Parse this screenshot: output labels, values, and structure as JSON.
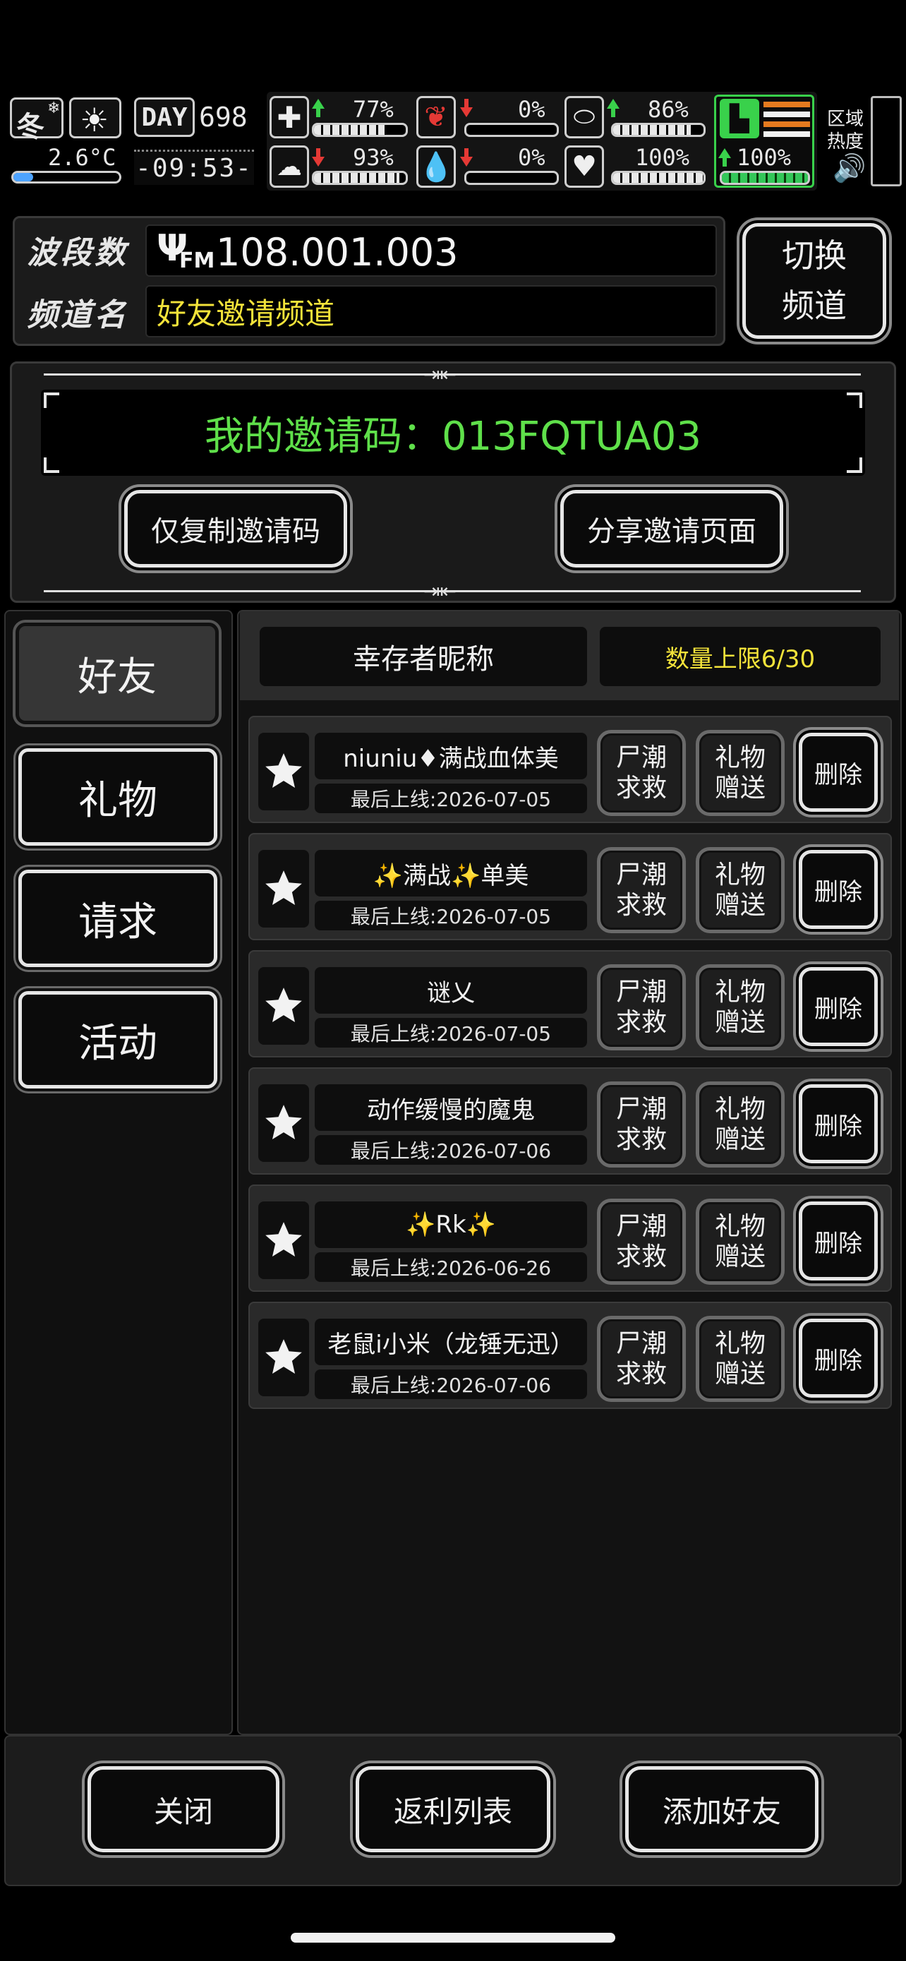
{
  "hud": {
    "season": "冬",
    "temperature": "2.6°C",
    "day_label": "DAY",
    "day_number": "698",
    "clock": "-09:53-",
    "region_heat_label_1": "区域",
    "region_heat_label_2": "热度",
    "stats": [
      {
        "key": "health",
        "value": "77%",
        "trend": "up",
        "fill": 0.77,
        "icon": "first-aid-icon"
      },
      {
        "key": "hunger",
        "value": "0%",
        "trend": "down",
        "fill": 0.0,
        "icon": "stomach-icon"
      },
      {
        "key": "sanity",
        "value": "86%",
        "trend": "up",
        "fill": 0.86,
        "icon": "pill-icon"
      },
      {
        "key": "mental",
        "value": "93%",
        "trend": "down",
        "fill": 0.93,
        "icon": "brain-icon"
      },
      {
        "key": "thirst",
        "value": "0%",
        "trend": "down",
        "fill": 0.0,
        "icon": "water-drop-icon"
      },
      {
        "key": "mood",
        "value": "100%",
        "trend": "none",
        "fill": 1.0,
        "icon": "heart-icon"
      },
      {
        "key": "stamina",
        "value": "100%",
        "trend": "up",
        "fill": 1.0,
        "icon": "boot-icon"
      }
    ]
  },
  "radio": {
    "band_label": "波段数",
    "frequency": "108.001.003",
    "fm_label": "FM",
    "channel_label": "频道名",
    "channel_name": "好友邀请频道",
    "switch_button": "切换\n频道",
    "switch_line1": "切换",
    "switch_line2": "频道"
  },
  "invite": {
    "code_text": "我的邀请码：013FQTUA03",
    "copy_button": "仅复制邀请码",
    "share_button": "分享邀请页面"
  },
  "tabs": [
    {
      "label": "好友",
      "active": true
    },
    {
      "label": "礼物",
      "active": false
    },
    {
      "label": "请求",
      "active": false
    },
    {
      "label": "活动",
      "active": false
    }
  ],
  "list_header": {
    "name_column": "幸存者昵称",
    "limit_text": "数量上限6/30"
  },
  "actions": {
    "rescue_line1": "尸潮",
    "rescue_line2": "求救",
    "gift_line1": "礼物",
    "gift_line2": "赠送",
    "delete": "删除"
  },
  "friends": [
    {
      "name": "niuniu♦满战血体美",
      "last_online": "最后上线:2026-07-05"
    },
    {
      "name": "✨满战✨单美",
      "last_online": "最后上线:2026-07-05"
    },
    {
      "name": "谜乂",
      "last_online": "最后上线:2026-07-05"
    },
    {
      "name": "动作缓慢的魔鬼",
      "last_online": "最后上线:2026-07-06"
    },
    {
      "name": "✨Rk✨",
      "last_online": "最后上线:2026-06-26"
    },
    {
      "name": "老鼠i小米（龙锤无迅）",
      "last_online": "最后上线:2026-07-06"
    }
  ],
  "footer": {
    "close": "关闭",
    "rebate": "返利列表",
    "add_friend": "添加好友"
  },
  "colors": {
    "accent_yellow": "#f3e33a",
    "invite_green": "#5fe04a",
    "up_green": "#39d14b",
    "down_red": "#e53935"
  }
}
